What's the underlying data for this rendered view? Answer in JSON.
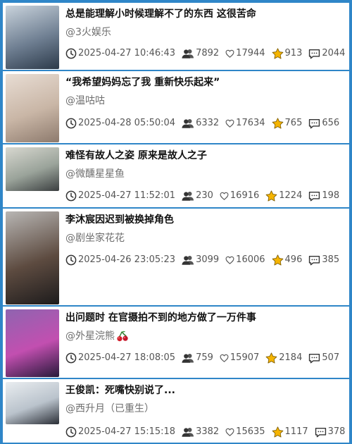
{
  "items": [
    {
      "title": "总是能理解小时候理解不了的东西 这很苦命",
      "author": "@3火娱乐",
      "time": "2025-04-27 10:46:43",
      "fans": "7892",
      "likes": "17944",
      "stars": "913",
      "comments": "2044",
      "thumb_colors": [
        "#c9d3dc",
        "#6f7f92",
        "#2c3a4a"
      ]
    },
    {
      "title": "“我希望妈妈忘了我 重新快乐起来”",
      "author": "@温咕咕",
      "time": "2025-04-28 05:50:04",
      "fans": "6332",
      "likes": "17634",
      "stars": "765",
      "comments": "656",
      "thumb_colors": [
        "#e8ddd4",
        "#c9b6a6",
        "#8d7a6d"
      ]
    },
    {
      "title": "难怪有故人之姿 原来是故人之子",
      "author": "@微醺星星鱼",
      "time": "2025-04-27 11:52:01",
      "fans": "230",
      "likes": "16916",
      "stars": "1224",
      "comments": "198",
      "thumb_colors": [
        "#d8d8d0",
        "#9aa39a",
        "#3b3f40"
      ]
    },
    {
      "title": "李沐宸因迟到被换掉角色",
      "author": "@剧坐家花花",
      "time": "2025-04-26 23:05:23",
      "fans": "3099",
      "likes": "16006",
      "stars": "496",
      "comments": "385",
      "thumb_colors": [
        "#b8b6b4",
        "#5d4b40",
        "#1d1b1c"
      ]
    },
    {
      "title": "出问题时 在官摄拍不到的地方做了一万件事",
      "author": "@外星浣熊",
      "author_emoji": "cherry-icon",
      "time": "2025-04-27 18:08:05",
      "fans": "759",
      "likes": "15907",
      "stars": "2184",
      "comments": "507",
      "thumb_colors": [
        "#8f64b0",
        "#c24fb0",
        "#27193a"
      ]
    },
    {
      "title": "王俊凯：死嘴快别说了...",
      "author": "@西升月（已重生）",
      "time": "2025-04-27 15:15:18",
      "fans": "3382",
      "likes": "15635",
      "stars": "1117",
      "comments": "378",
      "thumb_colors": [
        "#e9edf0",
        "#bac3cc",
        "#2a2e36"
      ]
    }
  ],
  "icons": {
    "time": "clock-icon",
    "fans": "people-icon",
    "likes": "heart-icon",
    "stars": "star-icon",
    "comments": "comment-icon"
  },
  "colors": {
    "background": "#2f86c8",
    "card": "#ffffff",
    "star": "#f5b400"
  }
}
